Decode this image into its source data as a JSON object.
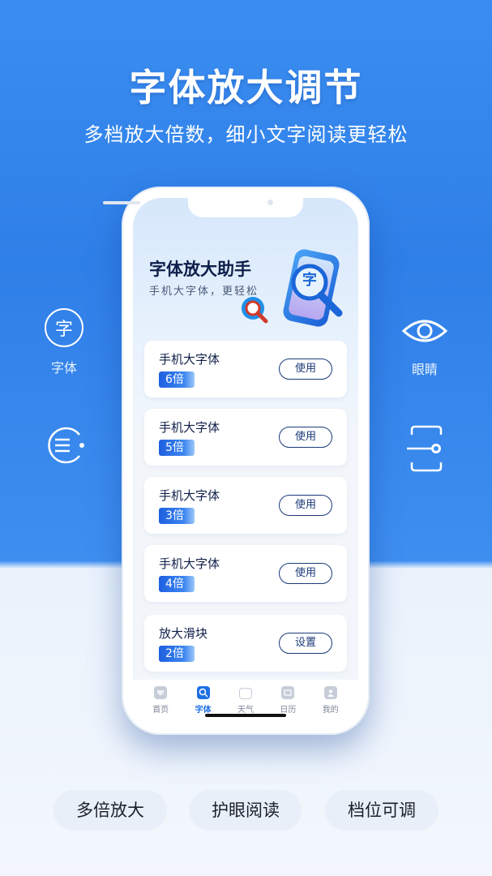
{
  "headline": "字体放大调节",
  "subline": "多档放大倍数，细小文字阅读更轻松",
  "side_features": [
    {
      "icon": "zi-character-icon",
      "glyph": "字",
      "label": "字体"
    },
    {
      "icon": "eye-icon",
      "label": "眼睛"
    },
    {
      "icon": "lines-icon",
      "label": ""
    },
    {
      "icon": "slider-scan-icon",
      "label": ""
    }
  ],
  "app": {
    "hero_title": "字体放大助手",
    "hero_subtitle": "手机大字体，更轻松",
    "hero_glyph": "字",
    "cards": [
      {
        "name": "手机大字体",
        "badge": "6倍",
        "button": "使用"
      },
      {
        "name": "手机大字体",
        "badge": "5倍",
        "button": "使用"
      },
      {
        "name": "手机大字体",
        "badge": "3倍",
        "button": "使用"
      },
      {
        "name": "手机大字体",
        "badge": "4倍",
        "button": "使用"
      },
      {
        "name": "放大滑块",
        "badge": "2倍",
        "button": "设置"
      }
    ],
    "tabs": [
      {
        "label": "首页",
        "icon": "home-icon",
        "active": false
      },
      {
        "label": "字体",
        "icon": "search-icon",
        "active": true
      },
      {
        "label": "天气",
        "icon": "weather-icon",
        "active": false
      },
      {
        "label": "日历",
        "icon": "calendar-icon",
        "active": false
      },
      {
        "label": "我的",
        "icon": "profile-icon",
        "active": false
      }
    ]
  },
  "bottom_pills": [
    "多倍放大",
    "护眼阅读",
    "档位可调"
  ],
  "colors": {
    "accent": "#1e6fe3",
    "background_top": "#3a8df0",
    "button_border": "#1b3a78"
  }
}
